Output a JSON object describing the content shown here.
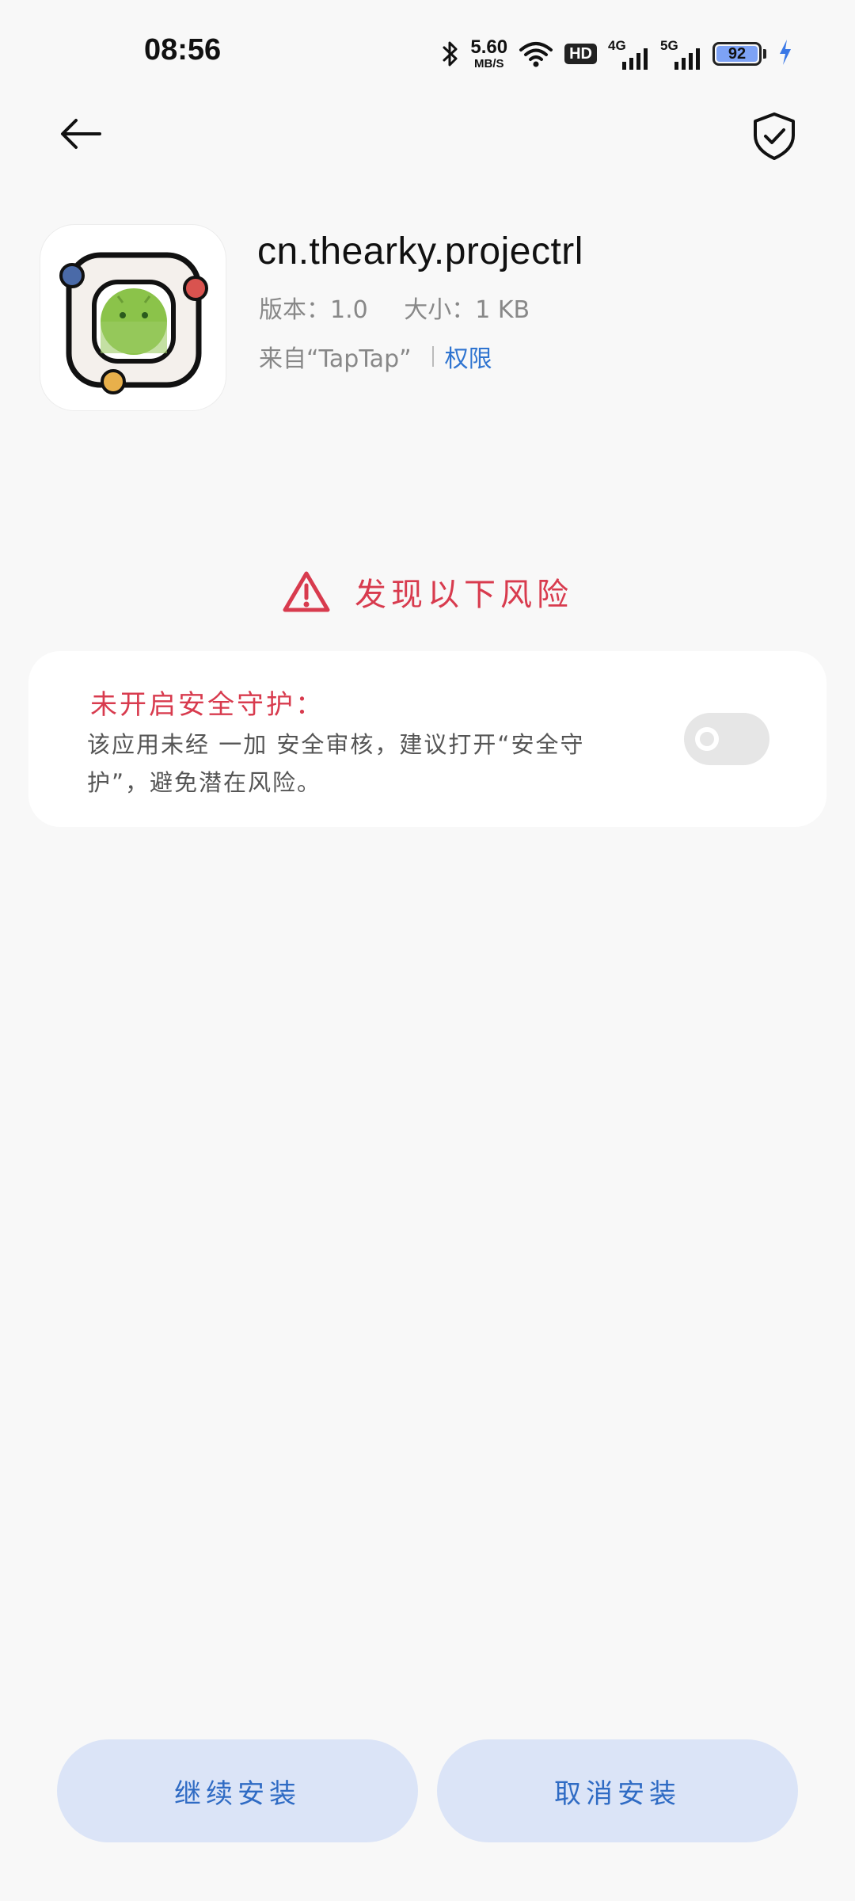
{
  "status_bar": {
    "time": "08:56",
    "net_speed_value": "5.60",
    "net_speed_unit": "MB/S",
    "hd_label": "HD",
    "sim1_label": "4G",
    "sim2_label": "5G",
    "battery_level": "92",
    "battery_color": "#7da2f5"
  },
  "app": {
    "package_name": "cn.thearky.projectrl",
    "version": "版本：1.0",
    "size": "大小：1 KB",
    "source": "来自“TapTap”",
    "permissions_link": "权限"
  },
  "risk": {
    "header": "发现以下风险",
    "card_title": "未开启安全守护：",
    "card_desc": "该应用未经 一加 安全审核，建议打开“安全守护”，避免潜在风险。",
    "toggle_on": false,
    "accent_color": "#d83b4e"
  },
  "actions": {
    "continue_label": "继续安装",
    "cancel_label": "取消安装"
  },
  "icons": [
    "back-arrow-icon",
    "shield-check-icon",
    "warning-icon",
    "bluetooth-icon",
    "wifi-icon",
    "signal-icon",
    "battery-icon",
    "charging-icon"
  ]
}
